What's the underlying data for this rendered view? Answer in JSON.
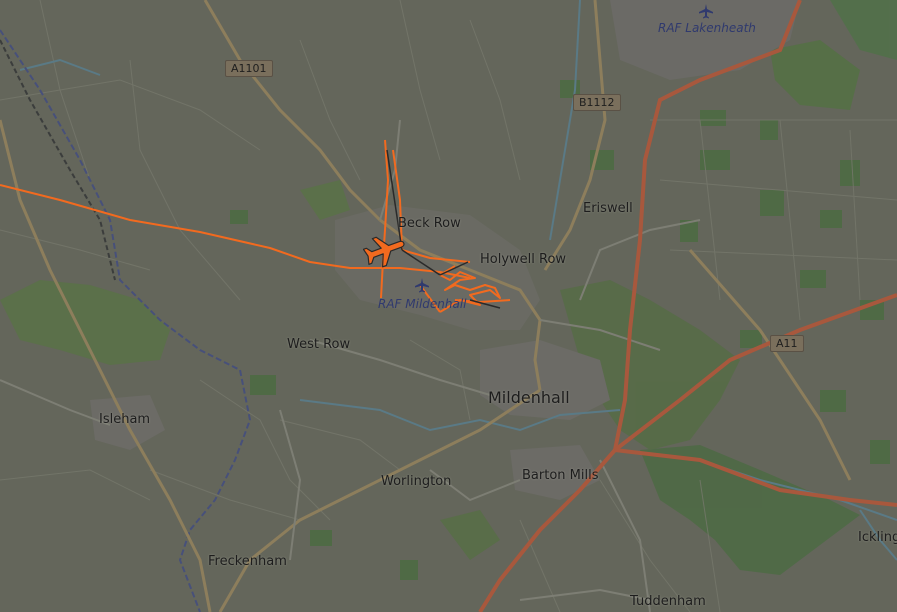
{
  "map": {
    "colors": {
      "land": "#64665b",
      "field_lines": "#76786c",
      "wood": "#4e6a45",
      "wood_light": "#5a7148",
      "airbase": "#6a6a62",
      "major_road": "#a8583d",
      "secondary_road": "#8d7e5c",
      "minor_road": "#7d7e74",
      "railway": "#3b3d3c",
      "water": "#5a7a86",
      "boundary": "#47507a",
      "flight_track": "#f26a1f",
      "aircraft": "#f26a1f"
    },
    "places": {
      "beck_row": "Beck Row",
      "holywell_row": "Holywell Row",
      "eriswell": "Eriswell",
      "west_row": "West Row",
      "mildenhall": "Mildenhall",
      "isleham": "Isleham",
      "worlington": "Worlington",
      "barton_mills": "Barton Mills",
      "freckenham": "Freckenham",
      "tuddenham": "Tuddenham",
      "icklingham": "Ickling"
    },
    "roads": {
      "a1101": "A1101",
      "b1112": "B1112",
      "a11": "A11"
    },
    "airports": {
      "raf_lakenheath": "RAF Lakenheath",
      "raf_mildenhall": "RAF Mildenhall"
    },
    "aircraft_icon": "airplane-icon",
    "airport_icon": "airplane-icon"
  }
}
